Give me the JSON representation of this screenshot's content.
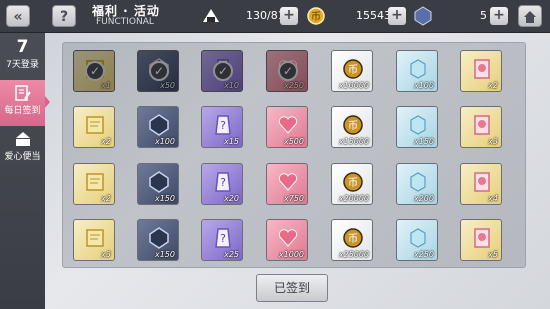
{
  "header": {
    "title": "福利 · 活动",
    "subtitle": "FUNCTIONAL",
    "stamina": "130/81",
    "coins": "15543",
    "gems": "5"
  },
  "sidebar": {
    "items": [
      {
        "big": "7",
        "label": "7天登录"
      },
      {
        "label": "每日签到"
      },
      {
        "label": "爱心便当"
      }
    ]
  },
  "grid": {
    "rows": [
      [
        "x1",
        "x50",
        "x10",
        "x250",
        "x10000",
        "x100",
        "x2"
      ],
      [
        "x2",
        "x100",
        "x15",
        "x500",
        "x15000",
        "x150",
        "x3"
      ],
      [
        "x2",
        "x150",
        "x20",
        "x750",
        "x20000",
        "x200",
        "x4"
      ],
      [
        "x3",
        "x150",
        "x25",
        "x1000",
        "x25000",
        "x250",
        "x5"
      ]
    ],
    "signed_days": 4
  },
  "footer": {
    "signin_label": "已签到"
  }
}
